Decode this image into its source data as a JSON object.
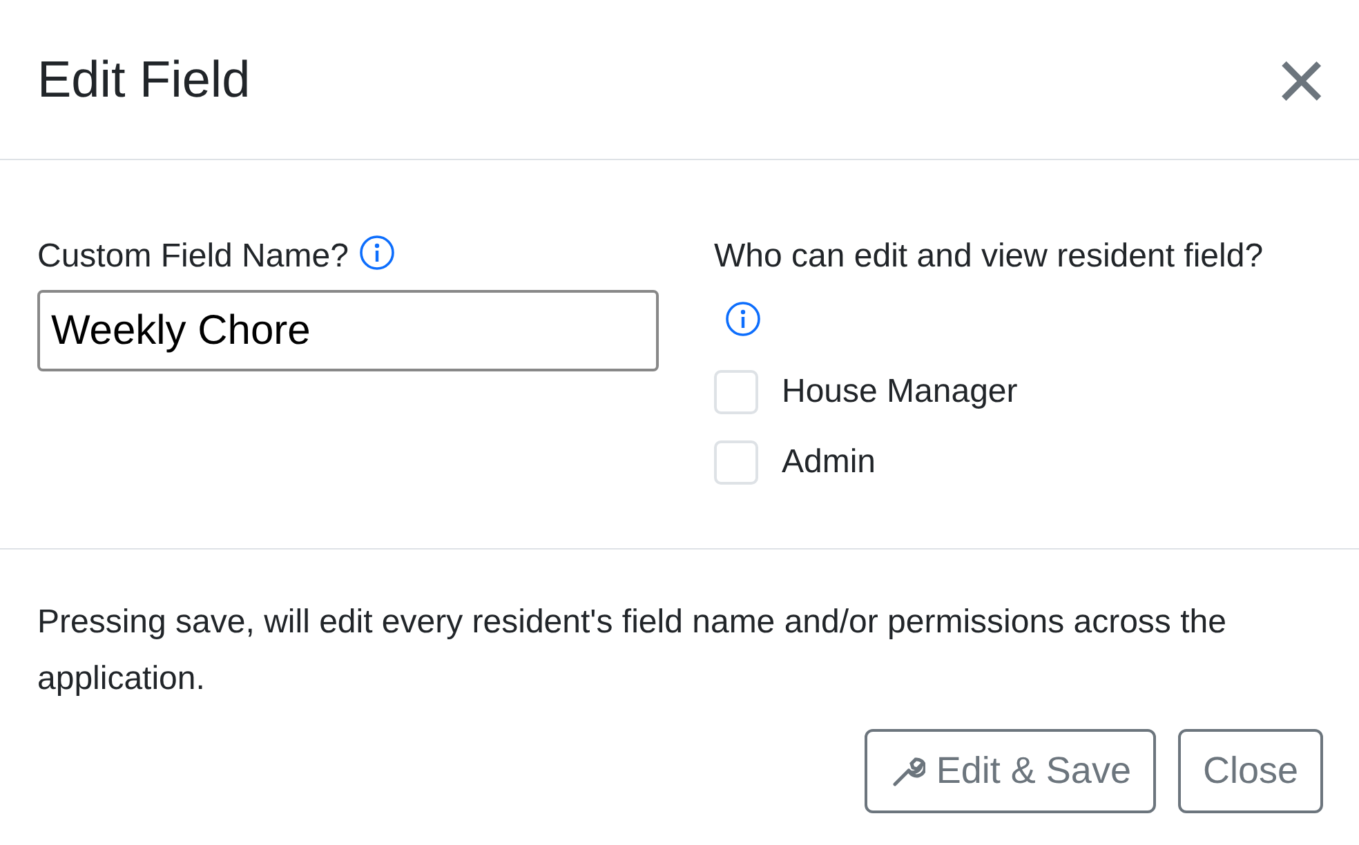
{
  "modal": {
    "title": "Edit Field",
    "close_icon": "×"
  },
  "name_field": {
    "label": "Custom Field Name?",
    "value": "Weekly Chore"
  },
  "permissions": {
    "label": "Who can edit and view resident field?",
    "options": [
      {
        "label": "House Manager",
        "checked": false
      },
      {
        "label": "Admin",
        "checked": false
      }
    ]
  },
  "notice": "Pressing save, will edit every resident's field name and/or permissions across the application.",
  "buttons": [
    {
      "label": "Edit & Save",
      "kind": "save"
    },
    {
      "label": "Close",
      "kind": "close"
    }
  ]
}
